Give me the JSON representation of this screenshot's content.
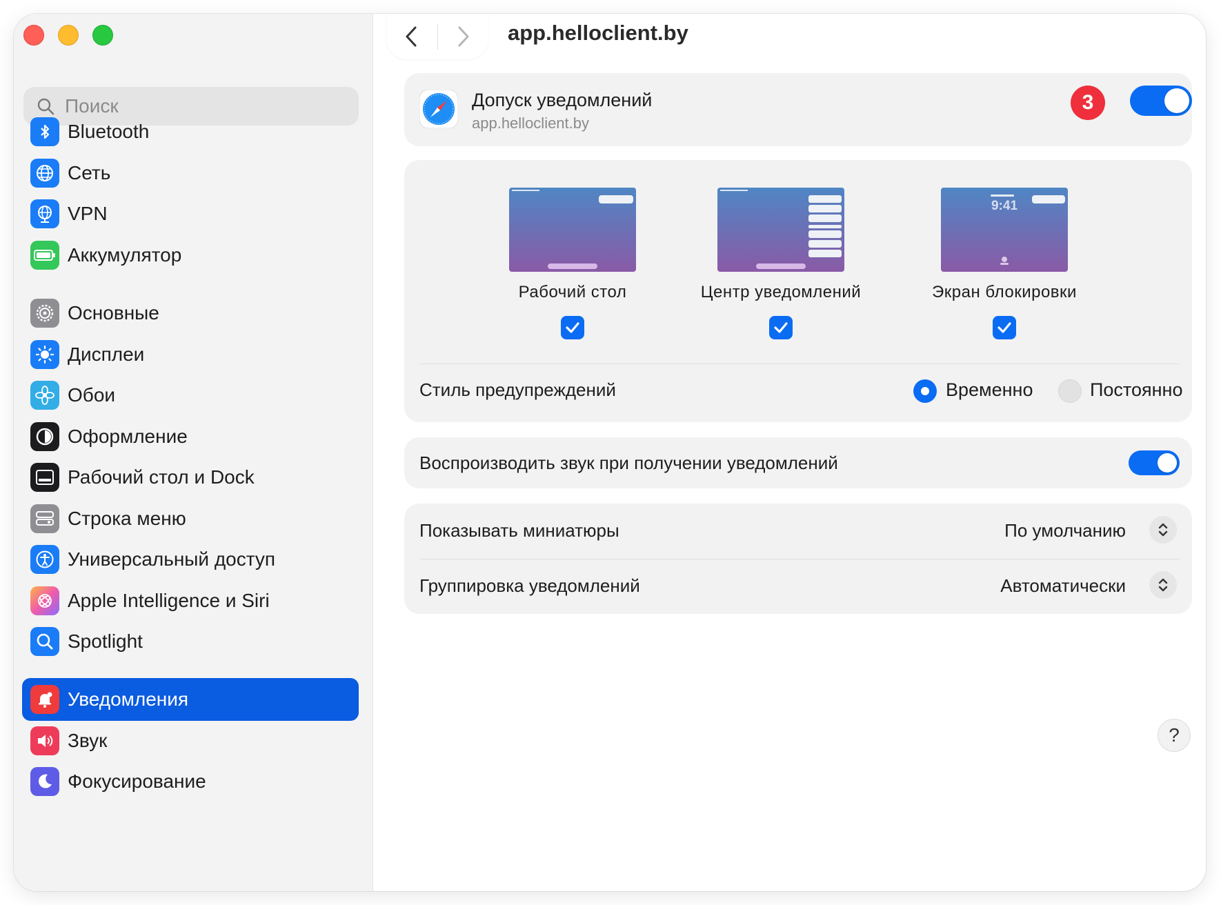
{
  "window": {
    "title": "app.helloclient.by"
  },
  "search": {
    "placeholder": "Поиск"
  },
  "sidebar": {
    "items": [
      {
        "label": "Bluetooth",
        "icon": "bluetooth-icon",
        "color": "#1a7cf6"
      },
      {
        "label": "Сеть",
        "icon": "globe-icon",
        "color": "#1a7cf6"
      },
      {
        "label": "VPN",
        "icon": "vpn-globe-icon",
        "color": "#1a7cf6"
      },
      {
        "label": "Аккумулятор",
        "icon": "battery-icon",
        "color": "#34c759"
      },
      {
        "label": "Основные",
        "icon": "gear-icon",
        "color": "#8e8e93"
      },
      {
        "label": "Дисплеи",
        "icon": "brightness-icon",
        "color": "#1a7cf6"
      },
      {
        "label": "Обои",
        "icon": "flower-icon",
        "color": "#32ade6"
      },
      {
        "label": "Оформление",
        "icon": "appearance-icon",
        "color": "#1c1c1e"
      },
      {
        "label": "Рабочий стол и Dock",
        "icon": "dock-icon",
        "color": "#1c1c1e"
      },
      {
        "label": "Строка меню",
        "icon": "menubar-icon",
        "color": "#8e8e93"
      },
      {
        "label": "Универсальный доступ",
        "icon": "accessibility-icon",
        "color": "#1a7cf6"
      },
      {
        "label": "Apple Intelligence и Siri",
        "icon": "siri-icon",
        "color": "#e05aa8"
      },
      {
        "label": "Spotlight",
        "icon": "spotlight-icon",
        "color": "#1a7cf6"
      },
      {
        "label": "Уведомления",
        "icon": "bell-icon",
        "color": "#ef3b3b",
        "selected": true
      },
      {
        "label": "Звук",
        "icon": "speaker-icon",
        "color": "#ef3b5a"
      },
      {
        "label": "Фокусирование",
        "icon": "moon-icon",
        "color": "#5e5ce6"
      }
    ]
  },
  "app": {
    "name": "Допуск уведомлений",
    "domain": "app.helloclient.by",
    "badge": "3",
    "allow_enabled": true
  },
  "styles": {
    "desktop": {
      "label": "Рабочий стол",
      "checked": true
    },
    "center": {
      "label": "Центр уведомлений",
      "checked": true
    },
    "lock": {
      "label": "Экран блокировки",
      "checked": true,
      "time": "9:41"
    }
  },
  "alert_style": {
    "label": "Стиль предупреждений",
    "options": [
      {
        "label": "Временно",
        "selected": true
      },
      {
        "label": "Постоянно",
        "selected": false
      }
    ]
  },
  "sound": {
    "label": "Воспроизводить звук при получении уведомлений",
    "enabled": true
  },
  "previews": {
    "label": "Показывать миниатюры",
    "value": "По умолчанию"
  },
  "grouping": {
    "label": "Группировка уведомлений",
    "value": "Автоматически"
  },
  "help": {
    "label": "?"
  },
  "colors": {
    "accent": "#0a6cf3",
    "selection": "#0a5ce0",
    "badge": "#ef2f3c"
  }
}
